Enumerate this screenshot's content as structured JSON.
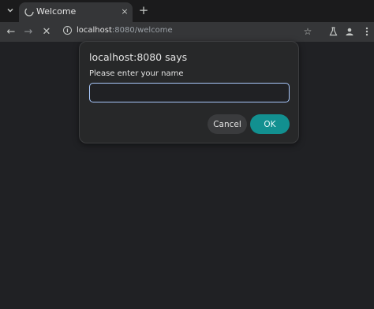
{
  "browser": {
    "tab_title": "Welcome",
    "tab_list_icon": "chevron-down",
    "new_tab_icon": "+",
    "close_icon": "×"
  },
  "toolbar": {
    "url_host": "localhost",
    "url_rest": ":8080/welcome",
    "back_icon": "←",
    "forward_icon": "→",
    "stop_icon": "✕",
    "bookmark_icon": "☆"
  },
  "dialog": {
    "title": "localhost:8080 says",
    "message": "Please enter your name",
    "input_value": "",
    "cancel_label": "Cancel",
    "ok_label": "OK"
  },
  "colors": {
    "accent": "#129090",
    "input_focus": "#a8c7fa",
    "background": "#202124"
  }
}
